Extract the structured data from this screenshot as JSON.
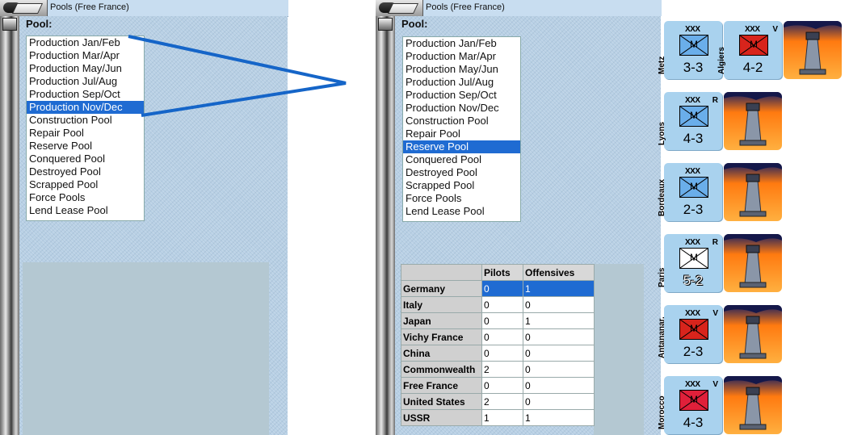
{
  "left_window": {
    "title": "Pools (Free France)",
    "pool_label": "Pool:",
    "list_items": [
      "Production Jan/Feb",
      "Production Mar/Apr",
      "Production May/Jun",
      "Production Jul/Aug",
      "Production Sep/Oct",
      "Production Nov/Dec",
      "Construction Pool",
      "Repair Pool",
      "Reserve Pool",
      "Conquered Pool",
      "Destroyed Pool",
      "Scrapped Pool",
      "Force Pools",
      "Lend Lease Pool"
    ],
    "selected_index": 5
  },
  "right_window": {
    "title": "Pools (Free France)",
    "pool_label": "Pool:",
    "list_items": [
      "Production Jan/Feb",
      "Production Mar/Apr",
      "Production May/Jun",
      "Production Jul/Aug",
      "Production Sep/Oct",
      "Production Nov/Dec",
      "Construction Pool",
      "Repair Pool",
      "Reserve Pool",
      "Conquered Pool",
      "Destroyed Pool",
      "Scrapped Pool",
      "Force Pools",
      "Lend Lease Pool"
    ],
    "selected_index": 8,
    "table": {
      "headers": [
        "",
        "Pilots",
        "Offensives"
      ],
      "rows": [
        {
          "country": "Germany",
          "pilots": "0",
          "offensives": "1"
        },
        {
          "country": "Italy",
          "pilots": "0",
          "offensives": "0"
        },
        {
          "country": "Japan",
          "pilots": "0",
          "offensives": "1"
        },
        {
          "country": "Vichy France",
          "pilots": "0",
          "offensives": "0"
        },
        {
          "country": "China",
          "pilots": "0",
          "offensives": "0"
        },
        {
          "country": "Commonwealth",
          "pilots": "2",
          "offensives": "0"
        },
        {
          "country": "Free France",
          "pilots": "0",
          "offensives": "0"
        },
        {
          "country": "United States",
          "pilots": "2",
          "offensives": "0"
        },
        {
          "country": "USSR",
          "pilots": "1",
          "offensives": "1"
        }
      ],
      "selected_row": 0
    }
  },
  "counters": [
    {
      "name": "Metz",
      "size": "XXX",
      "flag": "",
      "symbol": "M",
      "strength": "3-3",
      "bg": "#6aaeea",
      "m_color": "#000000",
      "str_white": false
    },
    {
      "name": "Algiers",
      "size": "XXX",
      "flag": "V",
      "symbol": "M",
      "strength": "4-2",
      "bg": "#d8241c",
      "m_color": "#000000",
      "str_white": false
    },
    {
      "name": "Lyons",
      "size": "XXX",
      "flag": "R",
      "symbol": "M",
      "strength": "4-3",
      "bg": "#6aaeea",
      "m_color": "#000000",
      "str_white": false
    },
    {
      "name": "Bordeaux",
      "size": "XXX",
      "flag": "",
      "symbol": "M",
      "strength": "2-3",
      "bg": "#6aaeea",
      "m_color": "#000000",
      "str_white": false
    },
    {
      "name": "Paris",
      "size": "XXX",
      "flag": "R",
      "symbol": "M",
      "strength": "5-2",
      "bg": "#ffffff",
      "m_color": "#000000",
      "str_white": true
    },
    {
      "name": "Antananar.",
      "size": "XXX",
      "flag": "V",
      "symbol": "M",
      "strength": "2-3",
      "bg": "#d8241c",
      "m_color": "#000000",
      "str_white": false
    },
    {
      "name": "Morocco",
      "size": "XXX",
      "flag": "V",
      "symbol": "M",
      "strength": "4-3",
      "bg": "#e0203a",
      "m_color": "#000000",
      "str_white": false
    }
  ],
  "colors": {
    "selection": "#1f6bd2",
    "panel": "#b7cfe4",
    "counter": "#a9d2ee",
    "arrow": "#1565c8"
  },
  "icons": {
    "window_control": "window-menu-icon",
    "hq_image": "lighthouse-icon"
  }
}
